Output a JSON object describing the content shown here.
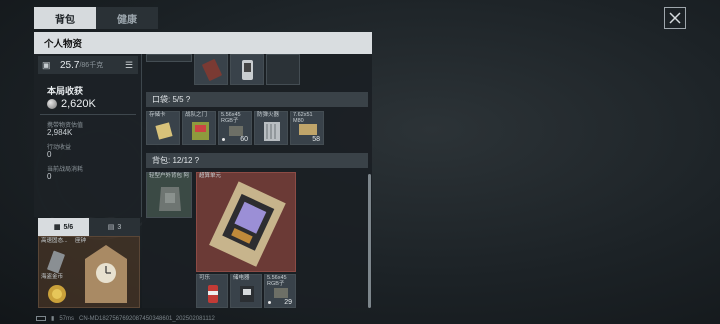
{
  "tabs": [
    "背包",
    "健康"
  ],
  "panel_title": "个人物资",
  "weight": {
    "current": "25.7",
    "max": "/86千克"
  },
  "earnings": {
    "title": "本局收获",
    "value": "2,620K",
    "carried_label": "携带物资估值",
    "carried_value": "2,984K",
    "action_label": "行动收益",
    "action_value": "0",
    "consumed_label": "当前战局消耗",
    "consumed_value": "0"
  },
  "pocket": {
    "header": "口袋: 5/5  ?"
  },
  "backpack": {
    "header": "背包: 12/12  ?"
  },
  "top_items": [
    {
      "label": ""
    },
    {
      "label": ""
    }
  ],
  "pocket_items": [
    {
      "label": "存储卡",
      "count": ""
    },
    {
      "label": "战队之门",
      "count": ""
    },
    {
      "label": "5.56x45 RGB子",
      "count": "60"
    },
    {
      "label": "防弹火器",
      "count": ""
    },
    {
      "label": "7.62x51 M80",
      "count": "58"
    }
  ],
  "backpack_items": [
    {
      "label": "轻型户外背包 阿",
      "count": ""
    },
    {
      "label": "超算单元",
      "count": ""
    },
    {
      "label": "可乐",
      "count": ""
    },
    {
      "label": "储电器",
      "count": ""
    },
    {
      "label": "5.56x45 RGB子",
      "count": "29"
    }
  ],
  "equip_tabs": [
    {
      "label": "5/6"
    },
    {
      "label": "3"
    }
  ],
  "equip_items": [
    "高速固态...",
    "座钟",
    "海盗金币"
  ],
  "footer": {
    "ping": "57ms",
    "id": "CN-MD1827567692087450348601_202502081112"
  },
  "colors": {
    "accent_tab": "#d6dadd",
    "item_red": "#6b3a36",
    "equip_bg": "#5a3e28"
  }
}
